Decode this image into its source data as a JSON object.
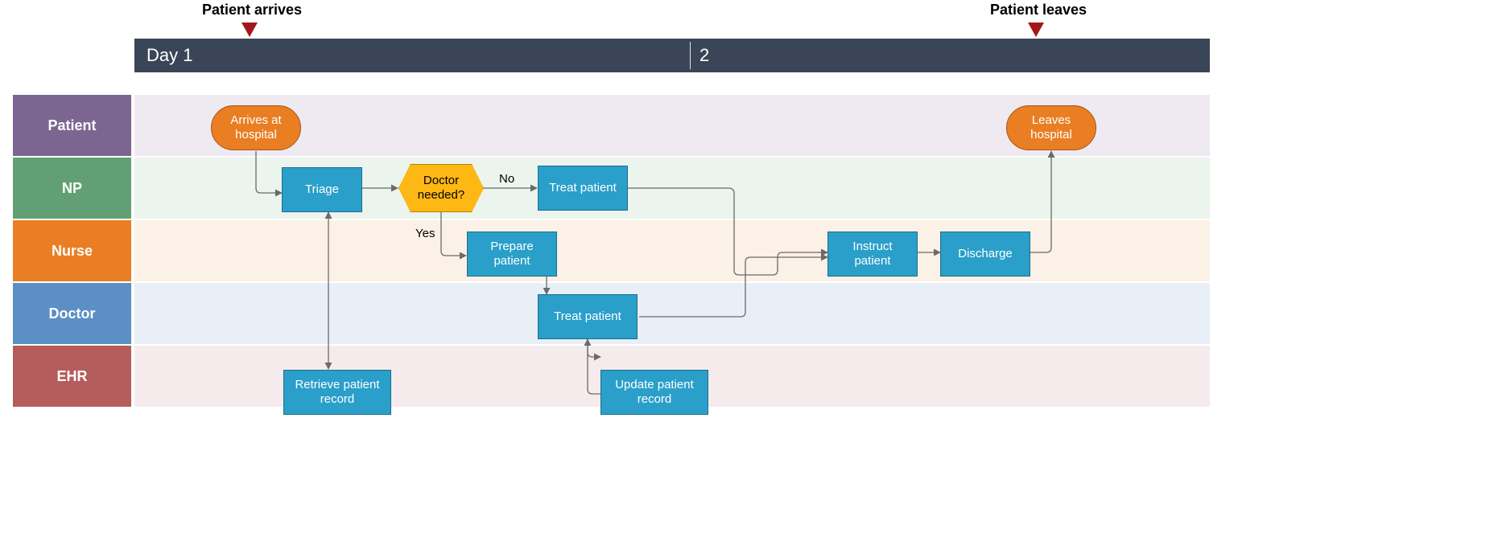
{
  "timeline": {
    "day1_label": "Day 1",
    "day2_label": "2",
    "event_arrive": "Patient arrives",
    "event_leave": "Patient leaves"
  },
  "lanes": {
    "patient": "Patient",
    "np": "NP",
    "nurse": "Nurse",
    "doctor": "Doctor",
    "ehr": "EHR"
  },
  "nodes": {
    "arrives": "Arrives at hospital",
    "triage": "Triage",
    "doctor_needed": "Doctor needed?",
    "treat_np": "Treat patient",
    "prepare": "Prepare patient",
    "treat_doctor": "Treat patient",
    "retrieve": "Retrieve patient record",
    "update": "Update patient record",
    "instruct": "Instruct patient",
    "discharge": "Discharge",
    "leaves": "Leaves hospital"
  },
  "edge_labels": {
    "no": "No",
    "yes": "Yes"
  }
}
